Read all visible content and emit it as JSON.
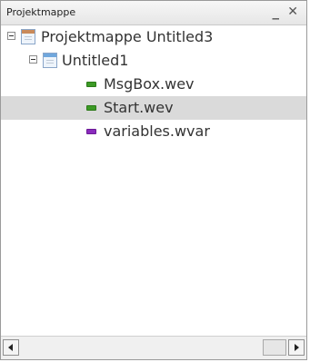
{
  "panel": {
    "title": "Projektmappe",
    "minimize_glyph": "_",
    "close_glyph": "✕"
  },
  "tree": {
    "project_label": "Projektmappe Untitled3",
    "untitled_label": "Untitled1",
    "files": [
      {
        "label": "MsgBox.wev",
        "type": "wev",
        "selected": false
      },
      {
        "label": "Start.wev",
        "type": "wev",
        "selected": true
      },
      {
        "label": "variables.wvar",
        "type": "wvar",
        "selected": false
      }
    ]
  },
  "colors": {
    "selection": "#dadada",
    "wev_icon": "#3c9a25",
    "wvar_icon": "#8a2bbd"
  },
  "icons": {
    "project": "project-icon",
    "untitled": "untitled-icon",
    "wev": "wev-file-icon",
    "wvar": "wvar-file-icon"
  }
}
